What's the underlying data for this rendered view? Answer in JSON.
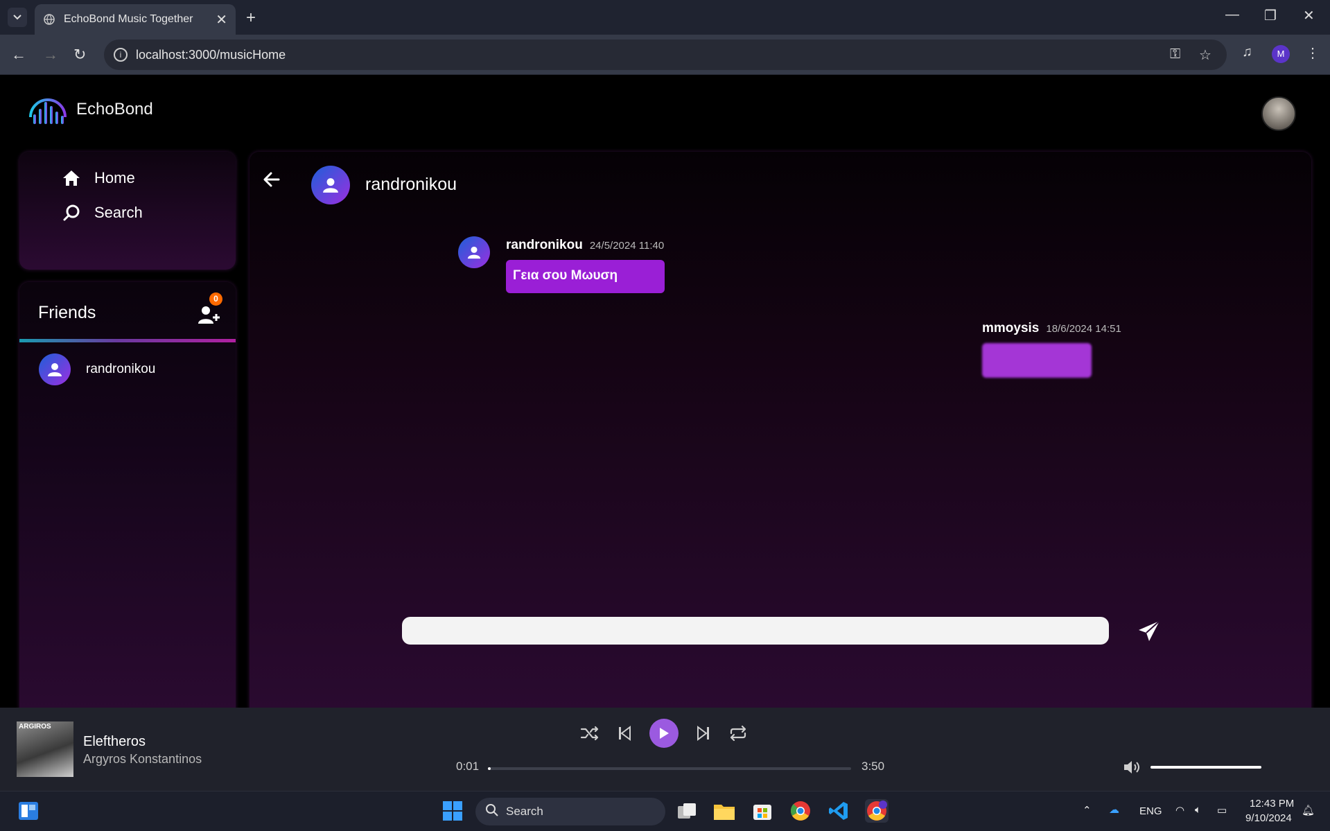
{
  "browser": {
    "tab_title": "EchoBond Music Together",
    "url": "localhost:3000/musicHome",
    "profile_initial": "M"
  },
  "app": {
    "brand": "EchoBond",
    "nav": [
      {
        "label": "Home",
        "icon": "home-icon"
      },
      {
        "label": "Search",
        "icon": "search-icon"
      }
    ],
    "friends": {
      "title": "Friends",
      "requests_badge": "0",
      "list": [
        {
          "name": "randronikou"
        }
      ]
    },
    "chat": {
      "contact_name": "randronikou",
      "messages": [
        {
          "sender": "randronikou",
          "time": "24/5/2024 11:40",
          "text": "Γεια σου Μωυση",
          "incoming": true
        },
        {
          "sender": "mmoysis",
          "time": "18/6/2024 14:51",
          "text": "",
          "incoming": false
        }
      ],
      "input_placeholder": ""
    }
  },
  "player": {
    "title": "Eleftheros",
    "artist": "Argyros Konstantinos",
    "cover_text": "ARGIROS",
    "elapsed": "0:01",
    "duration": "3:50",
    "progress_fraction": 0.004,
    "volume_fraction": 1.0
  },
  "taskbar": {
    "search_label": "Search",
    "language": "ENG",
    "time": "12:43 PM",
    "date": "9/10/2024"
  },
  "colors": {
    "accent": "#9a1fd6",
    "badge": "#ff6a00",
    "play": "#9b5ae0"
  }
}
